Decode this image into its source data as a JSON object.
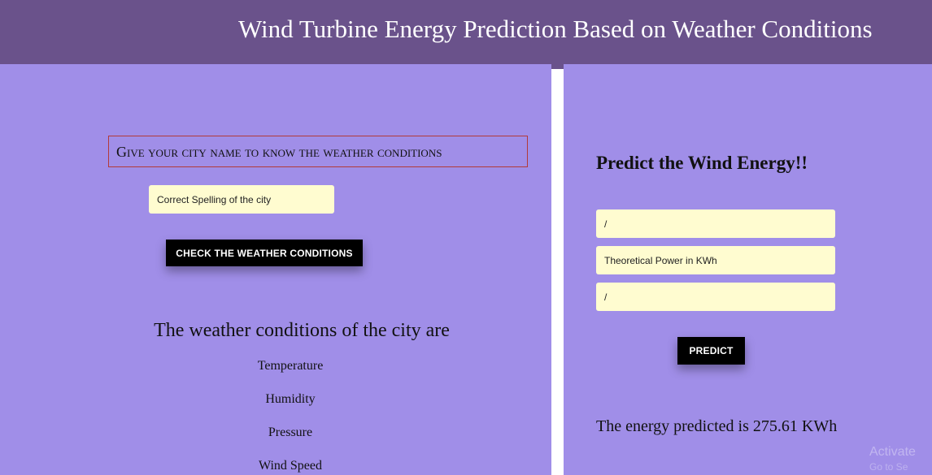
{
  "header": {
    "title": "Wind Turbine Energy Prediction Based on Weather Conditions",
    "color": "#6a528b"
  },
  "colors": {
    "panel_bg": "#a08ee8",
    "input_bg": "#fffcd0",
    "button_bg": "#000000"
  },
  "weather": {
    "prompt": "Give your city name to know the weather conditions",
    "city_input": {
      "placeholder": "Correct Spelling of the city",
      "value": ""
    },
    "check_button_label": "Check the weather conditions",
    "results_heading": "The weather conditions of the city are",
    "fields": [
      "Temperature",
      "Humidity",
      "Pressure",
      "Wind Speed"
    ]
  },
  "prediction": {
    "heading": "Predict the Wind Energy!!",
    "inputs": [
      {
        "placeholder": "/",
        "value": ""
      },
      {
        "placeholder": "Theoretical Power in KWh",
        "value": ""
      },
      {
        "placeholder": "/",
        "value": ""
      }
    ],
    "predict_button_label": "Predict",
    "result_text": "The energy predicted is 275.61 KWh"
  },
  "watermark": {
    "line1": "Activate",
    "line2": "Go to Se"
  }
}
